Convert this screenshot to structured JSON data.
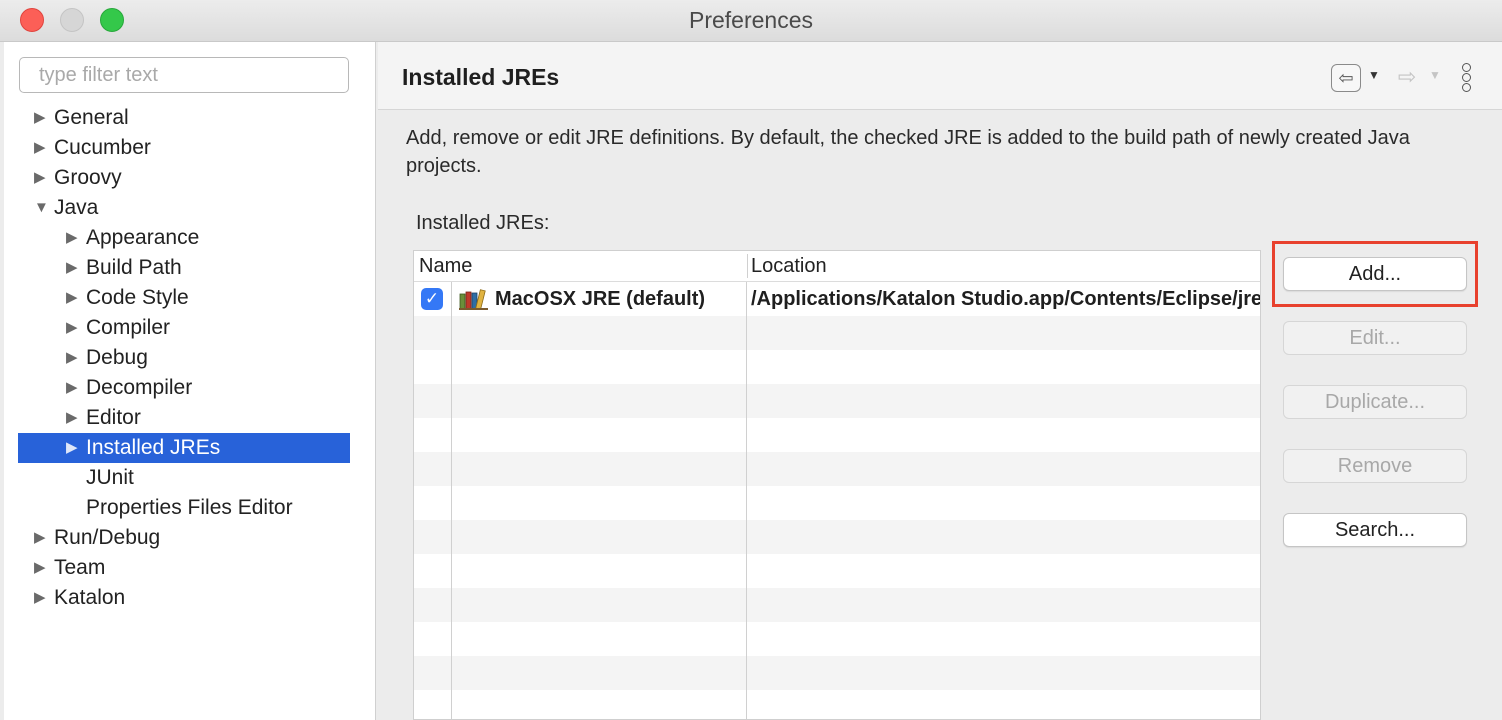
{
  "window": {
    "title": "Preferences"
  },
  "filter": {
    "placeholder": "type filter text",
    "value": ""
  },
  "tree": {
    "items": [
      {
        "label": "General"
      },
      {
        "label": "Cucumber"
      },
      {
        "label": "Groovy"
      },
      {
        "label": "Java"
      },
      {
        "label": "Appearance"
      },
      {
        "label": "Build Path"
      },
      {
        "label": "Code Style"
      },
      {
        "label": "Compiler"
      },
      {
        "label": "Debug"
      },
      {
        "label": "Decompiler"
      },
      {
        "label": "Editor"
      },
      {
        "label": "Installed JREs"
      },
      {
        "label": "JUnit"
      },
      {
        "label": "Properties Files Editor"
      },
      {
        "label": "Run/Debug"
      },
      {
        "label": "Team"
      },
      {
        "label": "Katalon"
      }
    ]
  },
  "page": {
    "title": "Installed JREs",
    "description": "Add, remove or edit JRE definitions. By default, the checked JRE is added to the build path of newly created Java projects.",
    "table_label": "Installed JREs:"
  },
  "table": {
    "columns": [
      "Name",
      "Location"
    ],
    "rows": [
      {
        "checked": true,
        "name": "MacOSX JRE (default)",
        "location": "/Applications/Katalon Studio.app/Contents/Eclipse/jre/Contents/Home"
      }
    ]
  },
  "buttons": {
    "add": "Add...",
    "edit": "Edit...",
    "duplicate": "Duplicate...",
    "remove": "Remove",
    "search": "Search..."
  },
  "icons": {
    "nav_back": "arrow-left-icon",
    "nav_forward": "arrow-right-icon",
    "view_menu": "vertical-dots-icon",
    "jre": "library-books-icon",
    "check": "checkmark-icon"
  },
  "colors": {
    "selection": "#2862d9",
    "checkbox": "#3478f6",
    "highlight": "#e8412e",
    "close": "#fc5f57",
    "maximize": "#34c84a"
  }
}
